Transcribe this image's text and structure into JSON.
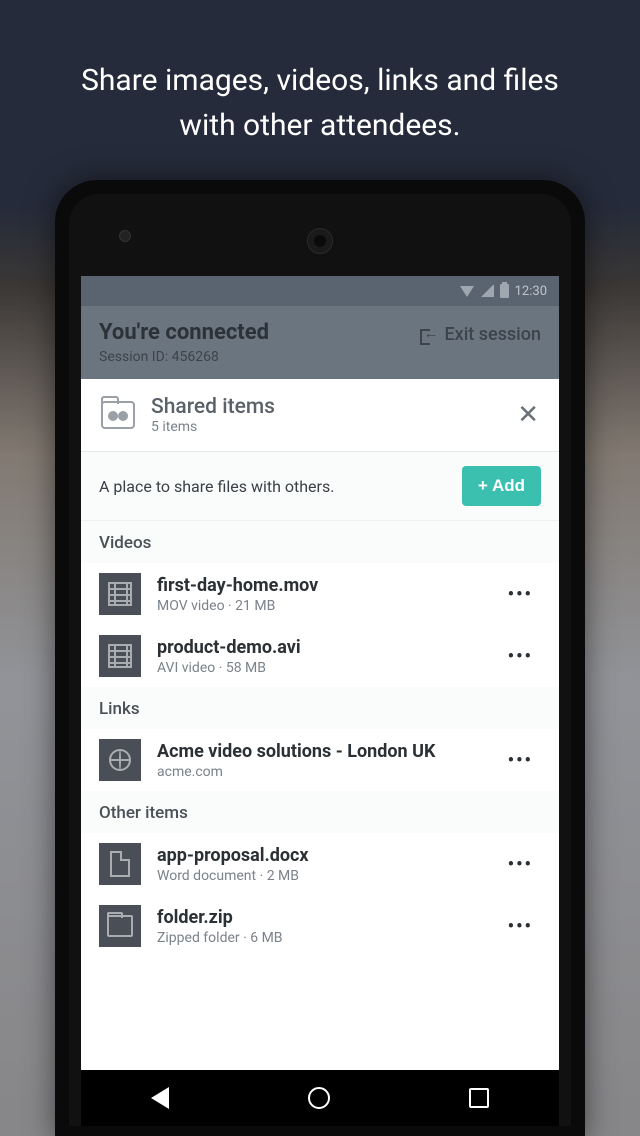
{
  "promo_line1": "Share images, videos, links and files",
  "promo_line2": "with other attendees.",
  "statusbar": {
    "time": "12:30"
  },
  "session": {
    "title": "You're connected",
    "id_label": "Session ID: 456268",
    "exit_label": "Exit session"
  },
  "shared": {
    "title": "Shared items",
    "subtitle": "5 items",
    "description": "A place to share files with others.",
    "add_label": "+ Add"
  },
  "sections": {
    "videos": "Videos",
    "links": "Links",
    "other": "Other items"
  },
  "items": {
    "v1": {
      "title": "first-day-home.mov",
      "sub": "MOV video  ·  21 MB"
    },
    "v2": {
      "title": "product-demo.avi",
      "sub": "AVI video  ·  58 MB"
    },
    "l1": {
      "title": "Acme video solutions - London UK",
      "sub": "acme.com"
    },
    "o1": {
      "title": "app-proposal.docx",
      "sub": "Word document  ·  2 MB"
    },
    "o2": {
      "title": "folder.zip",
      "sub": " Zipped folder  ·  6 MB"
    }
  }
}
